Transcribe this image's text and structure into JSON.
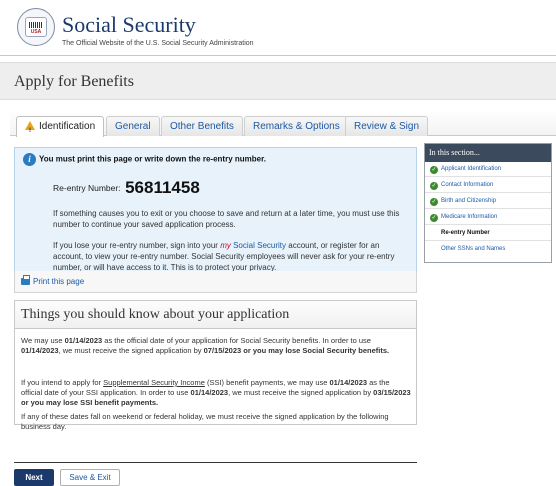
{
  "header": {
    "seal_text": "USA",
    "title": "Social Security",
    "subtitle": "The Official Website of the U.S. Social Security Administration"
  },
  "page": {
    "title": "Apply for Benefits"
  },
  "tabs": [
    {
      "label": "Identification",
      "active": true
    },
    {
      "label": "General"
    },
    {
      "label": "Other Benefits"
    },
    {
      "label": "Remarks & Options"
    },
    {
      "label": "Review & Sign"
    }
  ],
  "info": {
    "heading": "You must print this page or write down the re-entry number.",
    "reentry_label": "Re-entry Number:",
    "reentry_number": "56811458",
    "para1": "If something causes you to exit or you choose to save and return at a later time, you must use this number to continue your saved application process.",
    "para2_a": "If you lose your re-entry number, sign into your ",
    "my_text": "my",
    "ss_text": " Social Security",
    "para2_b": " account, or register for an account, to view your re-entry number. Social Security employees will never ask for your re-entry number, or will have access to it. This is to protect your privacy.",
    "print_label": "Print this page"
  },
  "things": {
    "title": "Things you should know about your application",
    "p1_a": "We may use ",
    "p1_date1": "01/14/2023",
    "p1_b": " as the official date of your application for Social Security benefits. In order to use ",
    "p1_date2": "01/14/2023",
    "p1_c": ", we must receive the signed application by ",
    "p1_bold": "07/15/2023 or you may lose Social Security benefits.",
    "p2_a": "If you intend to apply for ",
    "p2_link": "Supplemental Security Income",
    "p2_b": " (SSI) benefit payments, we may use ",
    "p2_date1": "01/14/2023",
    "p2_c": " as the official date of your SSI application. In order to use ",
    "p2_date2": "01/14/2023",
    "p2_d": ", we must receive the signed application by ",
    "p2_bold": "03/15/2023 or you may lose SSI benefit payments.",
    "p3": "If any of these dates fall on weekend or federal holiday, we must receive the signed application by the following business day."
  },
  "actions": {
    "next": "Next",
    "save_exit": "Save & Exit"
  },
  "sidebar": {
    "heading": "In this section...",
    "items": [
      {
        "label": "Applicant Identification",
        "complete": true
      },
      {
        "label": "Contact Information",
        "complete": true
      },
      {
        "label": "Birth and Citizenship",
        "complete": true
      },
      {
        "label": "Medicare Information",
        "complete": true
      },
      {
        "label": "Re-entry Number",
        "current": true
      },
      {
        "label": "Other SSNs and Names"
      }
    ]
  }
}
